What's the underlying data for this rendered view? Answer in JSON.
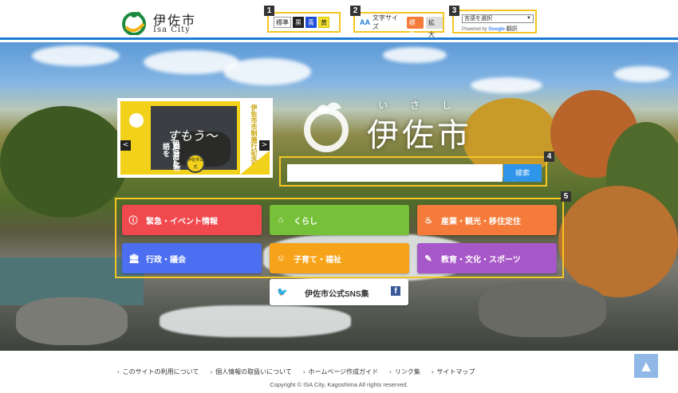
{
  "header": {
    "logo_jp": "伊佐市",
    "logo_en": "Isa City",
    "color_change": {
      "number": "1",
      "standard": "標準",
      "black": "黒",
      "blue": "青",
      "yellow": "黄"
    },
    "font_size": {
      "number": "2",
      "icon": "AA",
      "label": "文字サイズ",
      "standard": "標準",
      "large": "拡大"
    },
    "translate": {
      "number": "3",
      "select": "言語を選択",
      "powered_by": "Powered by",
      "google": "Google",
      "translate": "翻訳"
    }
  },
  "hero": {
    "city_name": "伊佐市",
    "ruby": [
      "い",
      "さ",
      "し"
    ],
    "slider": {
      "prev": "<",
      "next": ">",
      "vertical_text_1": "伊佐市を",
      "vertical_text_2": "舞台に物語を",
      "script_text": "すもう〜",
      "right_text": "伊佐市市制施行記念事業",
      "badge": "伊佐市公式"
    },
    "search": {
      "number": "4",
      "placeholder": "",
      "button": "検索"
    },
    "categories_number": "5",
    "categories": [
      {
        "label": "緊急・イベント情報",
        "icon": "info-icon",
        "glyph": "ⓘ",
        "color": "#f04a4f"
      },
      {
        "label": "くらし",
        "icon": "home-icon",
        "glyph": "⌂",
        "color": "#77c13a"
      },
      {
        "label": "産業・観光・移住定住",
        "icon": "tourism-icon",
        "glyph": "♨",
        "color": "#f47b39"
      },
      {
        "label": "行政・議会",
        "icon": "government-icon",
        "glyph": "🏛",
        "color": "#4b6ff0"
      },
      {
        "label": "子育て・福祉",
        "icon": "childcare-icon",
        "glyph": "☺",
        "color": "#f6a31a"
      },
      {
        "label": "教育・文化・スポーツ",
        "icon": "education-icon",
        "glyph": "✎",
        "color": "#a758c8"
      }
    ],
    "sns": {
      "label": "伊佐市公式SNS集",
      "twitter_glyph": "🐦",
      "facebook_glyph": "f"
    }
  },
  "footer": {
    "links": [
      "このサイトの利用について",
      "個人情報の取扱いについて",
      "ホームページ作成ガイド",
      "リンク集",
      "サイトマップ"
    ],
    "copyright": "Copyright © ISA City, Kagoshima All rights reserved.",
    "page_top": "▲"
  },
  "colors": {
    "accent": "#1e7bd6",
    "highlight": "#f3c623"
  }
}
